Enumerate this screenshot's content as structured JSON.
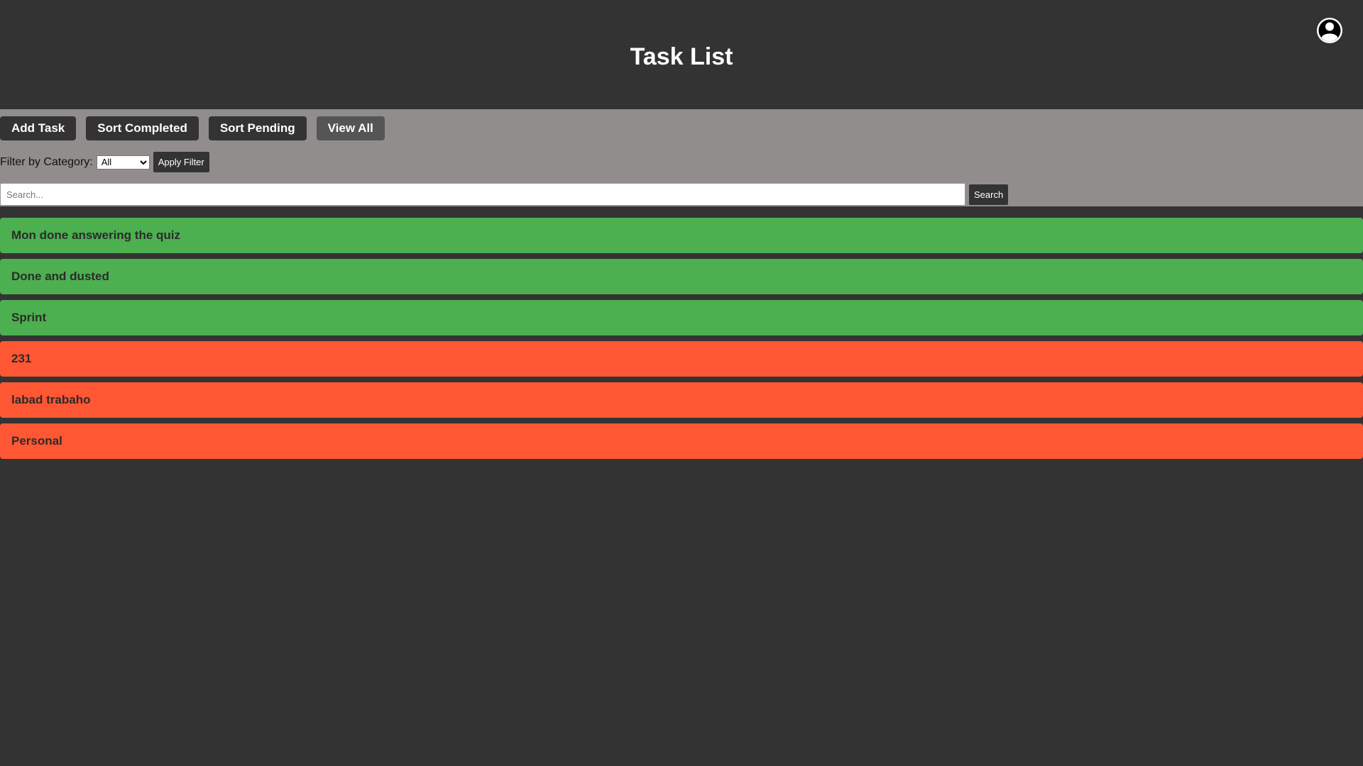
{
  "header": {
    "title": "Task List",
    "avatar_icon": "user-circle-icon"
  },
  "toolbar": {
    "buttons": [
      {
        "label": "Add Task"
      },
      {
        "label": "Sort Completed"
      },
      {
        "label": "Sort Pending"
      },
      {
        "label": "View All"
      }
    ],
    "filter_label": "Filter by Category:",
    "filter_selected": "All",
    "apply_filter_label": "Apply Filter",
    "search_placeholder": "Search...",
    "search_value": "",
    "search_button_label": "Search"
  },
  "tasks": [
    {
      "title": "Mon done answering the quiz",
      "status": "completed"
    },
    {
      "title": "Done and dusted",
      "status": "completed"
    },
    {
      "title": "Sprint",
      "status": "completed"
    },
    {
      "title": "231",
      "status": "pending"
    },
    {
      "title": "labad trabaho",
      "status": "pending"
    },
    {
      "title": "Personal",
      "status": "pending"
    }
  ],
  "colors": {
    "background": "#333333",
    "toolbar": "#918d8d",
    "completed": "#4caf50",
    "pending": "#ff5733"
  }
}
